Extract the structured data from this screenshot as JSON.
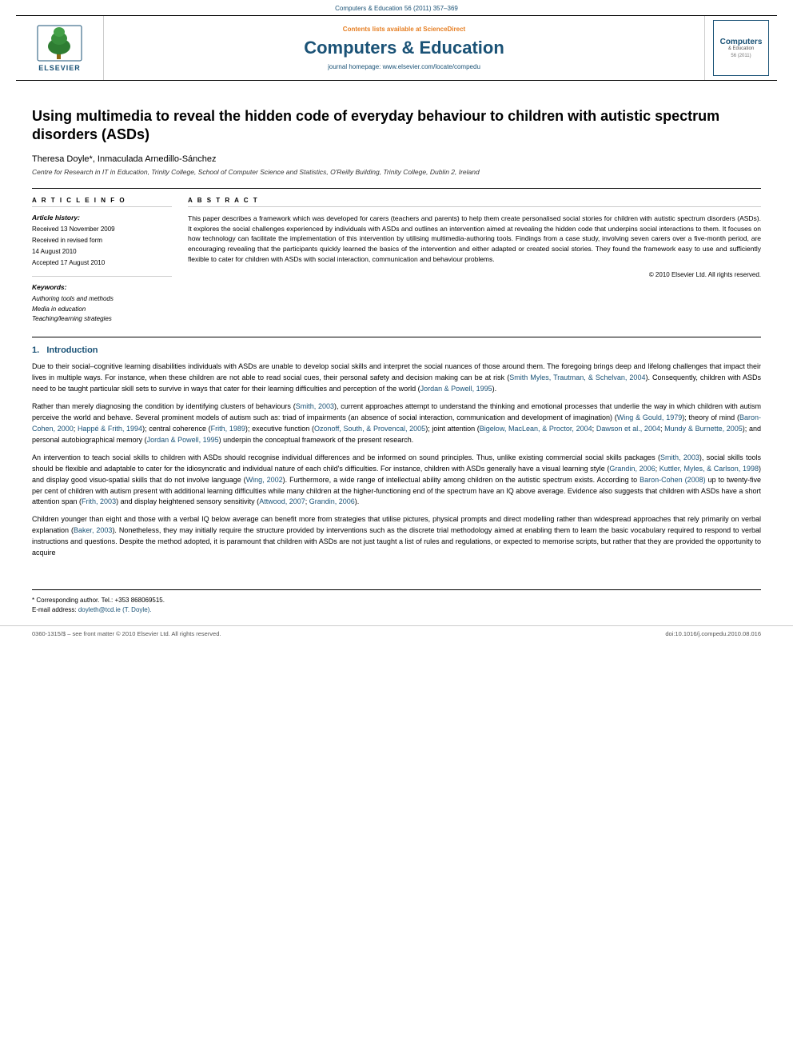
{
  "top_ref": "Computers & Education 56 (2011) 357–369",
  "header": {
    "sciencedirect_text": "Contents lists available at ScienceDirect",
    "sciencedirect_brand": "ScienceDirect",
    "journal_title": "Computers & Education",
    "homepage_label": "journal homepage:",
    "homepage_url": "www.elsevier.com/locate/compedu",
    "elsevier_label": "ELSEVIER",
    "ce_box_title": "Computers",
    "ce_box_sub": "& Education"
  },
  "article": {
    "title": "Using multimedia to reveal the hidden code of everyday behaviour to children with autistic spectrum disorders (ASDs)",
    "authors": "Theresa Doyle*, Inmaculada Arnedillo-Sánchez",
    "affiliation": "Centre for Research in IT in Education, Trinity College, School of Computer Science and Statistics, O'Reilly Building, Trinity College, Dublin 2, Ireland"
  },
  "article_info": {
    "label": "A R T I C L E   I N F O",
    "history_label": "Article history:",
    "received": "Received 13 November 2009",
    "revised": "Received in revised form",
    "revised_date": "14 August 2010",
    "accepted": "Accepted 17 August 2010",
    "keywords_label": "Keywords:",
    "keyword1": "Authoring tools and methods",
    "keyword2": "Media in education",
    "keyword3": "Teaching/learning strategies"
  },
  "abstract": {
    "label": "A B S T R A C T",
    "text": "This paper describes a framework which was developed for carers (teachers and parents) to help them create personalised social stories for children with autistic spectrum disorders (ASDs). It explores the social challenges experienced by individuals with ASDs and outlines an intervention aimed at revealing the hidden code that underpins social interactions to them. It focuses on how technology can facilitate the implementation of this intervention by utilising multimedia-authoring tools. Findings from a case study, involving seven carers over a five-month period, are encouraging revealing that the participants quickly learned the basics of the intervention and either adapted or created social stories. They found the framework easy to use and sufficiently flexible to cater for children with ASDs with social interaction, communication and behaviour problems.",
    "copyright": "© 2010 Elsevier Ltd. All rights reserved."
  },
  "sections": [
    {
      "number": "1.",
      "title": "Introduction",
      "paragraphs": [
        "Due to their social–cognitive learning disabilities individuals with ASDs are unable to develop social skills and interpret the social nuances of those around them. The foregoing brings deep and lifelong challenges that impact their lives in multiple ways. For instance, when these children are not able to read social cues, their personal safety and decision making can be at risk (Smith Myles, Trautman, & Schelvan, 2004). Consequently, children with ASDs need to be taught particular skill sets to survive in ways that cater for their learning difficulties and perception of the world (Jordan & Powell, 1995).",
        "Rather than merely diagnosing the condition by identifying clusters of behaviours (Smith, 2003), current approaches attempt to understand the thinking and emotional processes that underlie the way in which children with autism perceive the world and behave. Several prominent models of autism such as: triad of impairments (an absence of social interaction, communication and development of imagination) (Wing & Gould, 1979); theory of mind (Baron-Cohen, 2000; Happé & Frith, 1994); central coherence (Frith, 1989); executive function (Ozonoff, South, & Provencal, 2005); joint attention (Bigelow, MacLean, & Proctor, 2004; Dawson et al., 2004; Mundy & Burnette, 2005); and personal autobiographical memory (Jordan & Powell, 1995) underpin the conceptual framework of the present research.",
        "An intervention to teach social skills to children with ASDs should recognise individual differences and be informed on sound principles. Thus, unlike existing commercial social skills packages (Smith, 2003), social skills tools should be flexible and adaptable to cater for the idiosyncratic and individual nature of each child's difficulties. For instance, children with ASDs generally have a visual learning style (Grandin, 2006; Kuttler, Myles, & Carlson, 1998) and display good visuo-spatial skills that do not involve language (Wing, 2002). Furthermore, a wide range of intellectual ability among children on the autistic spectrum exists. According to Baron-Cohen (2008) up to twenty-five per cent of children with autism present with additional learning difficulties while many children at the higher-functioning end of the spectrum have an IQ above average. Evidence also suggests that children with ASDs have a short attention span (Frith, 2003) and display heightened sensory sensitivity (Attwood, 2007; Grandin, 2006).",
        "Children younger than eight and those with a verbal IQ below average can benefit more from strategies that utilise pictures, physical prompts and direct modelling rather than widespread approaches that rely primarily on verbal explanation (Baker, 2003). Nonetheless, they may initially require the structure provided by interventions such as the discrete trial methodology aimed at enabling them to learn the basic vocabulary required to respond to verbal instructions and questions. Despite the method adopted, it is paramount that children with ASDs are not just taught a list of rules and regulations, or expected to memorise scripts, but rather that they are provided the opportunity to acquire"
      ]
    }
  ],
  "footnotes": {
    "corresponding": "* Corresponding author. Tel.: +353 868069515.",
    "email_label": "E-mail address:",
    "email": "doyleth@tcd.ie (T. Doyle)."
  },
  "footer": {
    "left": "0360-1315/$ – see front matter © 2010 Elsevier Ltd. All rights reserved.",
    "doi": "doi:10.1016/j.compedu.2010.08.016"
  }
}
